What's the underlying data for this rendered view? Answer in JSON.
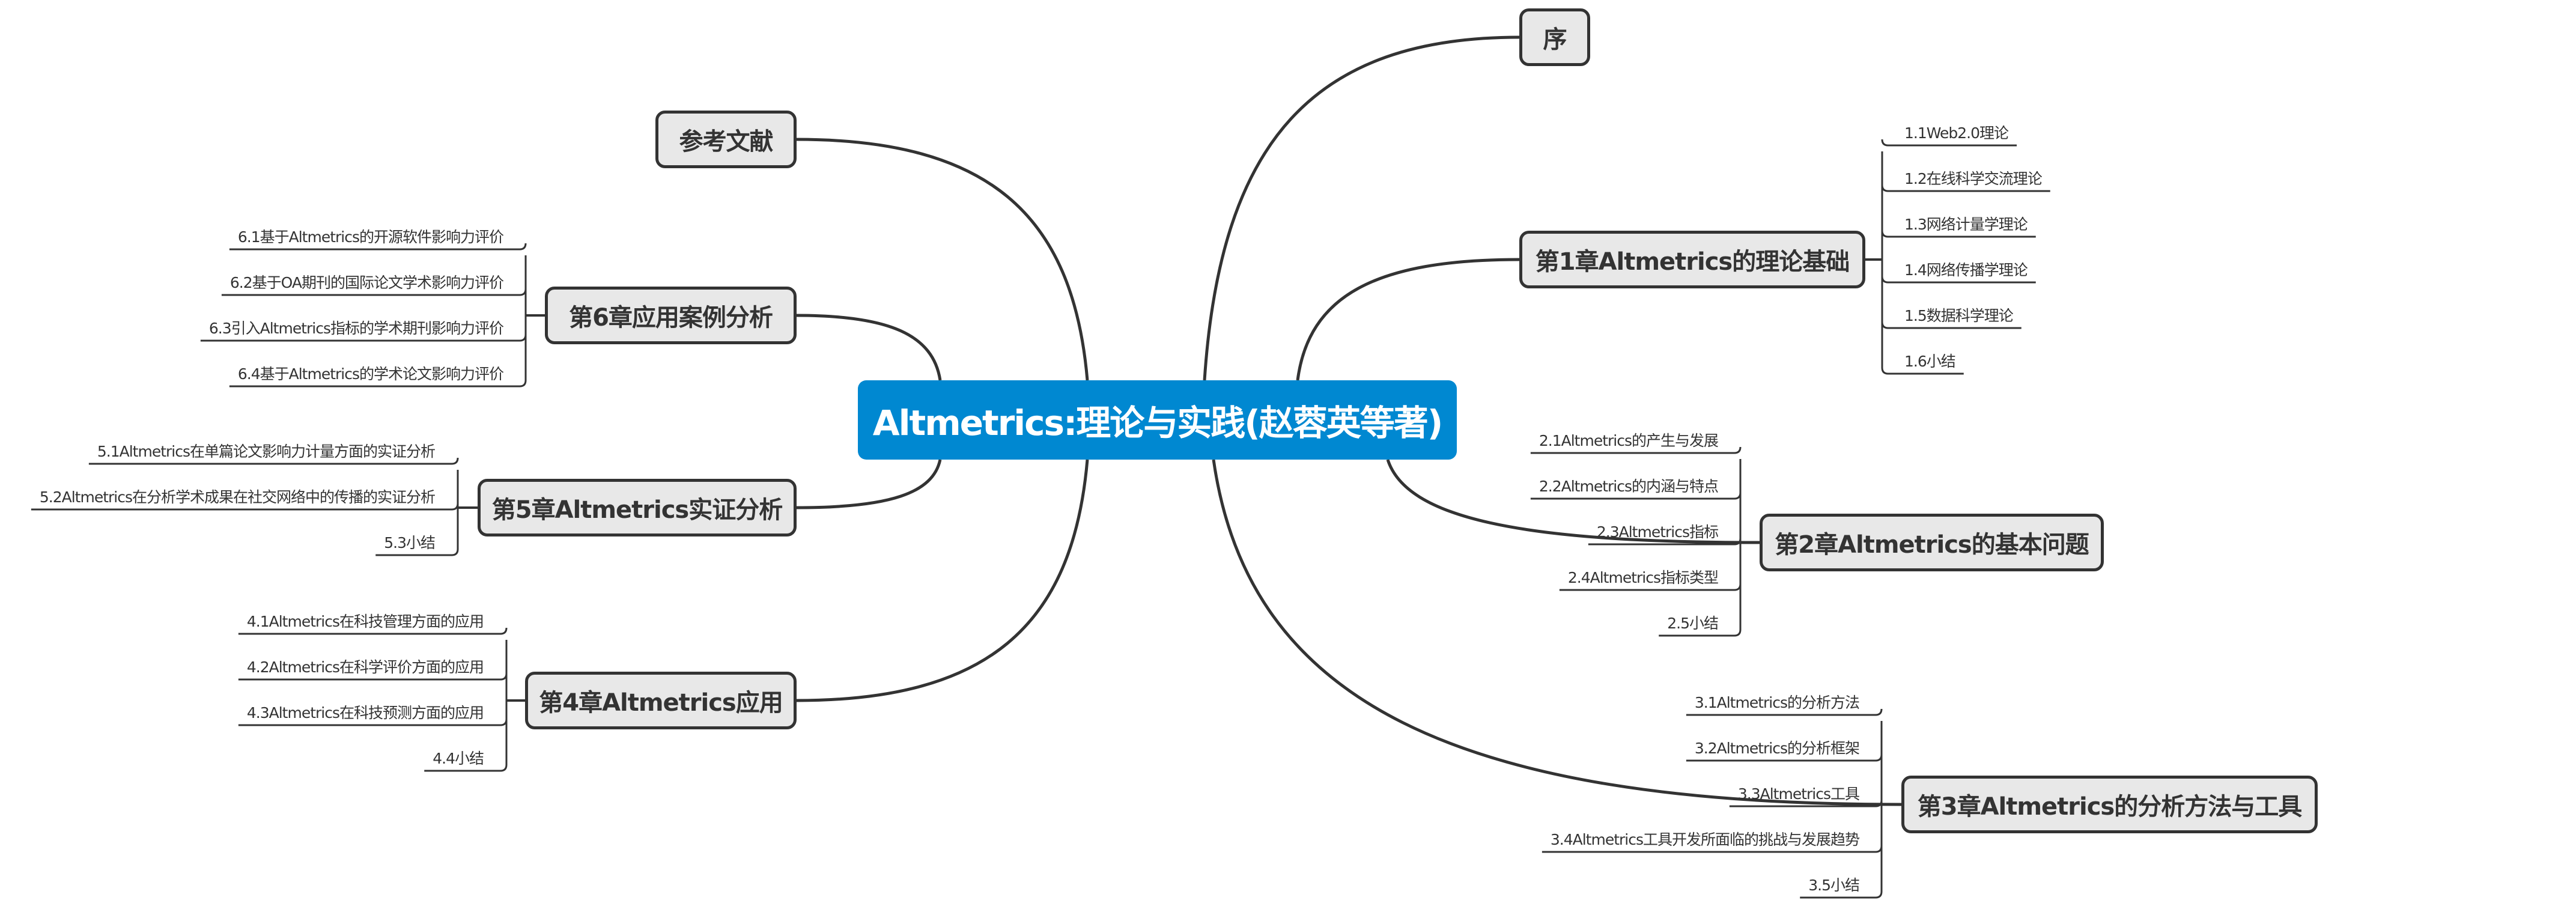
{
  "central": {
    "label": "Altmetrics:理论与实践(赵蓉英等著)",
    "color": "#0088d1"
  },
  "branches": [
    {
      "id": "preface",
      "label": "序",
      "side": "right",
      "children": []
    },
    {
      "id": "ch1",
      "label": "第1章Altmetrics的理论基础",
      "side": "right",
      "children": [
        "1.1Web2.0理论",
        "1.2在线科学交流理论",
        "1.3网络计量学理论",
        "1.4网络传播学理论",
        "1.5数据科学理论",
        "1.6小结"
      ]
    },
    {
      "id": "ch2",
      "label": "第2章Altmetrics的基本问题",
      "side": "right",
      "children": [
        "2.1Altmetrics的产生与发展",
        "2.2Altmetrics的内涵与特点",
        "2.3Altmetrics指标",
        "2.4Altmetrics指标类型",
        "2.5小结"
      ]
    },
    {
      "id": "ch3",
      "label": "第3章Altmetrics的分析方法与工具",
      "side": "right",
      "children": [
        "3.1Altmetrics的分析方法",
        "3.2Altmetrics的分析框架",
        "3.3Altmetrics工具",
        "3.4Altmetrics工具开发所面临的挑战与发展趋势",
        "3.5小结"
      ]
    },
    {
      "id": "refs",
      "label": "参考文献",
      "side": "left",
      "children": []
    },
    {
      "id": "ch6",
      "label": "第6章应用案例分析",
      "side": "left",
      "children": [
        "6.1基于Altmetrics的开源软件影响力评价",
        "6.2基于OA期刊的国际论文学术影响力评价",
        "6.3引入Altmetrics指标的学术期刊影响力评价",
        "6.4基于Altmetrics的学术论文影响力评价"
      ]
    },
    {
      "id": "ch5",
      "label": "第5章Altmetrics实证分析",
      "side": "left",
      "children": [
        "5.1Altmetrics在单篇论文影响力计量方面的实证分析",
        "5.2Altmetrics在分析学术成果在社交网络中的传播的实证分析",
        "5.3小结"
      ]
    },
    {
      "id": "ch4",
      "label": "第4章Altmetrics应用",
      "side": "left",
      "children": [
        "4.1Altmetrics在科技管理方面的应用",
        "4.2Altmetrics在科学评价方面的应用",
        "4.3Altmetrics在科技预测方面的应用",
        "4.4小结"
      ]
    }
  ],
  "colors": {
    "line": "#333333",
    "node_fill": "#e8e8e8",
    "node_border": "#333333",
    "text": "#333333"
  }
}
